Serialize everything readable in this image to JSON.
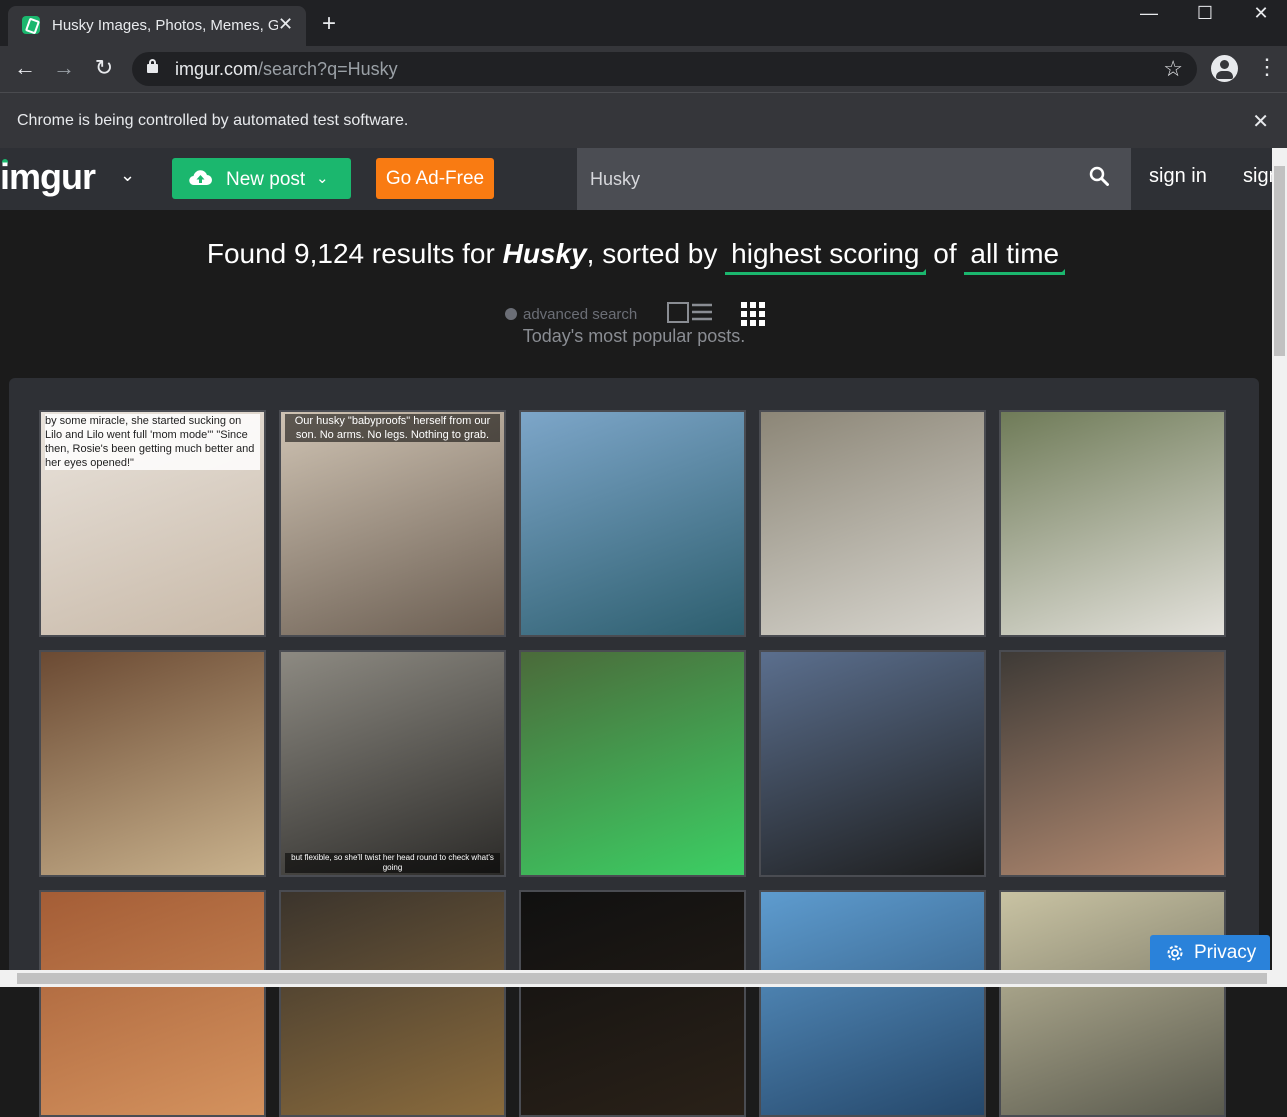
{
  "browser": {
    "tab_title": "Husky Images, Photos, Memes, G",
    "tab_close": "✕",
    "new_tab": "+",
    "win_min": "—",
    "win_max": "☐",
    "win_close": "✕",
    "back": "←",
    "forward": "→",
    "reload": "↻",
    "url_host": "imgur.com",
    "url_path": "/search?q=Husky",
    "star": "☆",
    "menu": "⋮",
    "infobar_message": "Chrome is being controlled by automated test software.",
    "infobar_close": "✕"
  },
  "header": {
    "logo": "imgur",
    "logo_chevron": "⌄",
    "new_post_label": "New post",
    "new_post_chevron": "⌄",
    "ad_free_label": "Go Ad-Free",
    "search_value": "Husky",
    "sign_in": "sign in",
    "sign_up": "sign up"
  },
  "results": {
    "prefix": "Found 9,124 results for",
    "query": "Husky",
    "mid": ", sorted by",
    "sort": "highest scoring",
    "of": "of",
    "period": "all time",
    "advanced_search": "advanced search",
    "subtitle": "Today's most popular posts."
  },
  "thumbnails": [
    {
      "caption": "by some miracle, she started sucking on Lilo and Lilo went full 'mom mode'\" \"Since then, Rosie's been getting much better and her eyes opened!\"",
      "colors": [
        "#e9e3dc",
        "#c8b9a8"
      ]
    },
    {
      "caption": "Our husky \"babyproofs\" herself from our son. No arms. No legs. Nothing to grab.",
      "colors": [
        "#cfc3b3",
        "#6b5e52"
      ]
    },
    {
      "caption": "",
      "colors": [
        "#7da6c9",
        "#2d5e6e"
      ]
    },
    {
      "caption": "",
      "colors": [
        "#8c8677",
        "#d8d6cf"
      ]
    },
    {
      "caption": "",
      "colors": [
        "#6f7b58",
        "#e4e2dc"
      ]
    },
    {
      "caption": "",
      "colors": [
        "#6b4a33",
        "#c9b28d"
      ]
    },
    {
      "caption": "but flexible, so she'll twist her head round to check what's going",
      "colors": [
        "#8d8a82",
        "#2b2a28"
      ]
    },
    {
      "caption": "",
      "colors": [
        "#4b6a3a",
        "#3ccf64"
      ]
    },
    {
      "caption": "",
      "colors": [
        "#5b6f8e",
        "#1d1d1d"
      ]
    },
    {
      "caption": "",
      "colors": [
        "#3e3a36",
        "#b88e74"
      ]
    },
    {
      "caption": "",
      "colors": [
        "#a45d36",
        "#d4925e"
      ]
    },
    {
      "caption": "",
      "colors": [
        "#3b342c",
        "#8a6b3d"
      ]
    },
    {
      "caption": "",
      "colors": [
        "#101010",
        "#2a2118"
      ]
    },
    {
      "caption": "",
      "colors": [
        "#5e9ccf",
        "#25476a"
      ]
    },
    {
      "caption": "",
      "colors": [
        "#c9c3a3",
        "#5a5a4e"
      ]
    }
  ],
  "privacy_label": "Privacy",
  "colors": {
    "green": "#1bb76e",
    "orange": "#f97b12",
    "header_bg": "#2e3035",
    "page_bg": "#1b1b1b",
    "privacy_blue": "#2a82da"
  }
}
